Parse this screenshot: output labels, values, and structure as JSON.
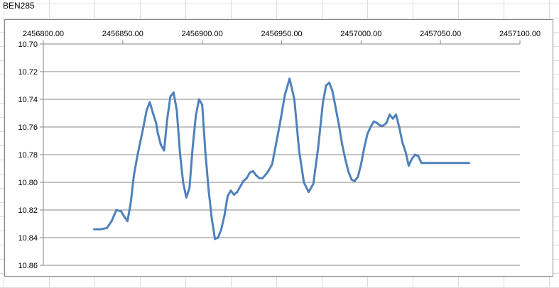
{
  "sheet": {
    "title_cell": "BEN285"
  },
  "chart_data": {
    "type": "line",
    "title": "",
    "xlabel": "",
    "ylabel": "",
    "x_axis_position": "top",
    "y_axis_reversed": true,
    "xlim": [
      2456800,
      2457100
    ],
    "ylim": [
      10.7,
      10.86
    ],
    "x_ticks": [
      "2456800.00",
      "2456850.00",
      "2456900.00",
      "2456950.00",
      "2457000.00",
      "2457050.00",
      "2457100.00"
    ],
    "y_ticks": [
      "10.70",
      "10.72",
      "10.74",
      "10.76",
      "10.78",
      "10.80",
      "10.82",
      "10.84",
      "10.86"
    ],
    "grid": true,
    "legend": "none",
    "series": [
      {
        "color": "#4f81bd",
        "x": [
          2456832,
          2456836,
          2456840,
          2456843,
          2456846,
          2456849,
          2456851,
          2456853,
          2456855,
          2456857,
          2456859,
          2456861,
          2456863,
          2456865,
          2456867,
          2456869,
          2456871,
          2456872,
          2456874,
          2456876,
          2456878,
          2456880,
          2456882,
          2456884,
          2456886,
          2456888,
          2456890,
          2456892,
          2456894,
          2456896,
          2456898,
          2456900,
          2456902,
          2456904,
          2456906,
          2456908,
          2456910,
          2456912,
          2456914,
          2456916,
          2456918,
          2456920,
          2456922,
          2456924,
          2456926,
          2456928,
          2456930,
          2456932,
          2456934,
          2456936,
          2456938,
          2456941,
          2456944,
          2456946,
          2456949,
          2456952,
          2456955,
          2456958,
          2456961,
          2456964,
          2456967,
          2456970,
          2456973,
          2456976,
          2456978,
          2456980,
          2456982,
          2456984,
          2456986,
          2456988,
          2456990,
          2456992,
          2456994,
          2456996,
          2456998,
          2457000,
          2457002,
          2457004,
          2457006,
          2457008,
          2457010,
          2457012,
          2457014,
          2457016,
          2457018,
          2457020,
          2457022,
          2457024,
          2457026,
          2457028,
          2457030,
          2457032,
          2457034,
          2457036,
          2457038,
          2457040,
          2457042,
          2457044,
          2457046,
          2457048,
          2457050,
          2457052,
          2457054,
          2457056,
          2457058,
          2457060,
          2457062,
          2457064,
          2457066,
          2457068
        ],
        "y": [
          10.834,
          10.834,
          10.833,
          10.828,
          10.82,
          10.821,
          10.825,
          10.828,
          10.815,
          10.795,
          10.782,
          10.771,
          10.76,
          10.748,
          10.742,
          10.75,
          10.757,
          10.764,
          10.773,
          10.777,
          10.754,
          10.738,
          10.735,
          10.748,
          10.779,
          10.8,
          10.811,
          10.804,
          10.775,
          10.752,
          10.74,
          10.744,
          10.778,
          10.805,
          10.826,
          10.841,
          10.84,
          10.834,
          10.824,
          10.81,
          10.806,
          10.809,
          10.807,
          10.803,
          10.799,
          10.797,
          10.793,
          10.792,
          10.795,
          10.797,
          10.797,
          10.793,
          10.787,
          10.775,
          10.757,
          10.737,
          10.725,
          10.74,
          10.777,
          10.8,
          10.807,
          10.801,
          10.775,
          10.742,
          10.73,
          10.728,
          10.734,
          10.746,
          10.758,
          10.772,
          10.783,
          10.792,
          10.798,
          10.799,
          10.796,
          10.787,
          10.775,
          10.765,
          10.76,
          10.756,
          10.757,
          10.759,
          10.759,
          10.757,
          10.751,
          10.754,
          10.751,
          10.76,
          10.771,
          10.778,
          10.788,
          10.783,
          10.78,
          10.781,
          10.786,
          10.786,
          10.786,
          10.786,
          10.786,
          10.786,
          10.786,
          10.786,
          10.786,
          10.786,
          10.786,
          10.786,
          10.786,
          10.786,
          10.786,
          10.786
        ]
      }
    ]
  }
}
